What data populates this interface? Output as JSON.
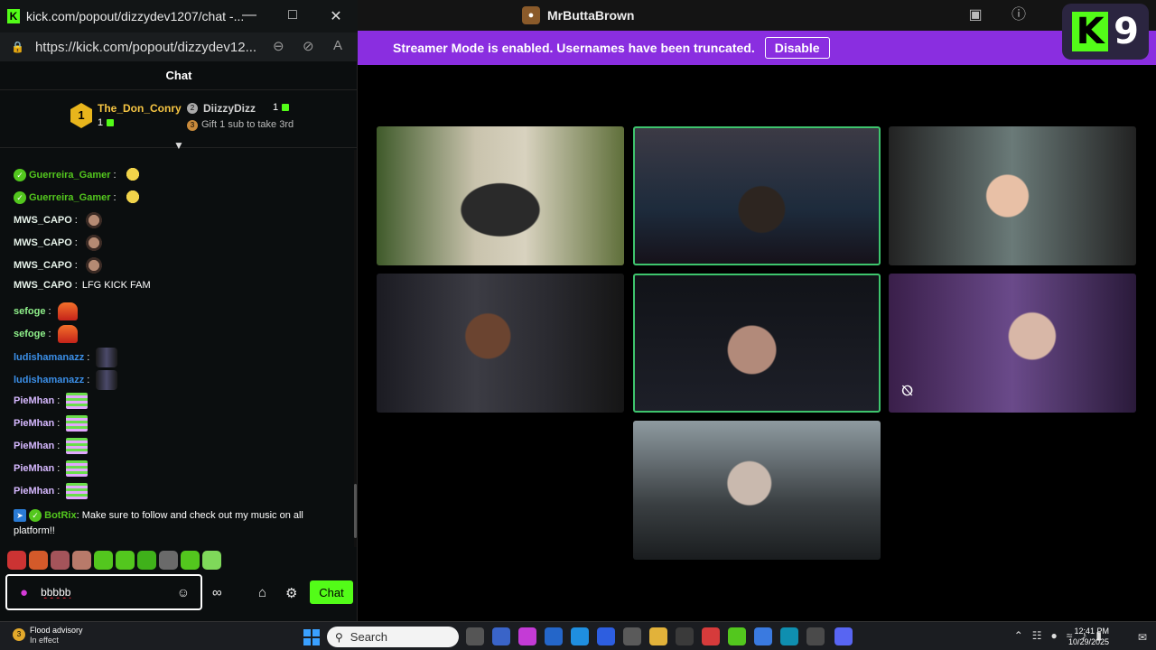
{
  "app": {
    "title": "MrButtaBrown",
    "banner_text": "Streamer Mode is enabled. Usernames have been truncated.",
    "disable_label": "Disable",
    "kick_badge_number": "9"
  },
  "chat_window": {
    "title": "kick.com/popout/dizzydev1207/chat -...",
    "url": "https://kick.com/popout/dizzydev12...",
    "header": "Chat",
    "leaderboard": {
      "first": {
        "rank": "1",
        "name": "The_Don_Conry",
        "count": "1"
      },
      "second": {
        "rank": "2",
        "name": "DiizzyDizz",
        "count": "1"
      },
      "gift_rank": "3",
      "gift_text": "Gift 1 sub to take 3rd"
    },
    "messages": [
      {
        "user": "Guerreira_Gamer",
        "color": "#53c71e",
        "verified": true,
        "text": "",
        "emote": "face"
      },
      {
        "user": "Guerreira_Gamer",
        "color": "#53c71e",
        "verified": true,
        "text": "",
        "emote": "face"
      },
      {
        "user": "MWS_CAPO",
        "color": "#e7f3ea",
        "text": "",
        "emote": "capo"
      },
      {
        "user": "MWS_CAPO",
        "color": "#e7f3ea",
        "text": "",
        "emote": "capo"
      },
      {
        "user": "MWS_CAPO",
        "color": "#e7f3ea",
        "text": "",
        "emote": "capo"
      },
      {
        "user": "MWS_CAPO",
        "color": "#e7f3ea",
        "text": "LFG KICK FAM",
        "emote": ""
      },
      {
        "user": "sefoge",
        "color": "#90f28b",
        "text": "",
        "emote": "fire"
      },
      {
        "user": "sefoge",
        "color": "#90f28b",
        "text": "",
        "emote": "fire"
      },
      {
        "user": "ludishamanazz",
        "color": "#3b8fe8",
        "text": "",
        "emote": "ludi"
      },
      {
        "user": "ludishamanazz",
        "color": "#3b8fe8",
        "text": "",
        "emote": "ludi"
      },
      {
        "user": "PieMhan",
        "color": "#d6b8ff",
        "text": "",
        "emote": "good"
      },
      {
        "user": "PieMhan",
        "color": "#d6b8ff",
        "text": "",
        "emote": "good"
      },
      {
        "user": "PieMhan",
        "color": "#d6b8ff",
        "text": "",
        "emote": "good"
      },
      {
        "user": "PieMhan",
        "color": "#d6b8ff",
        "text": "",
        "emote": "good"
      },
      {
        "user": "PieMhan",
        "color": "#d6b8ff",
        "text": "",
        "emote": "good"
      }
    ],
    "botrix": {
      "user": "BotRix",
      "text": "Make sure to follow and check out my music on all",
      "text2": "platform!!"
    },
    "input_value": "bbbbb",
    "send_label": "Chat"
  },
  "taskbar": {
    "weather_title": "Flood advisory",
    "weather_sub": "In effect",
    "weather_badge": "3",
    "search_placeholder": "Search",
    "time": "12:41 PM",
    "date": "10/29/2025"
  },
  "colors": {
    "kick_green": "#53fc18",
    "banner_purple": "#8a2ee0",
    "active_border": "#3ec46d"
  }
}
